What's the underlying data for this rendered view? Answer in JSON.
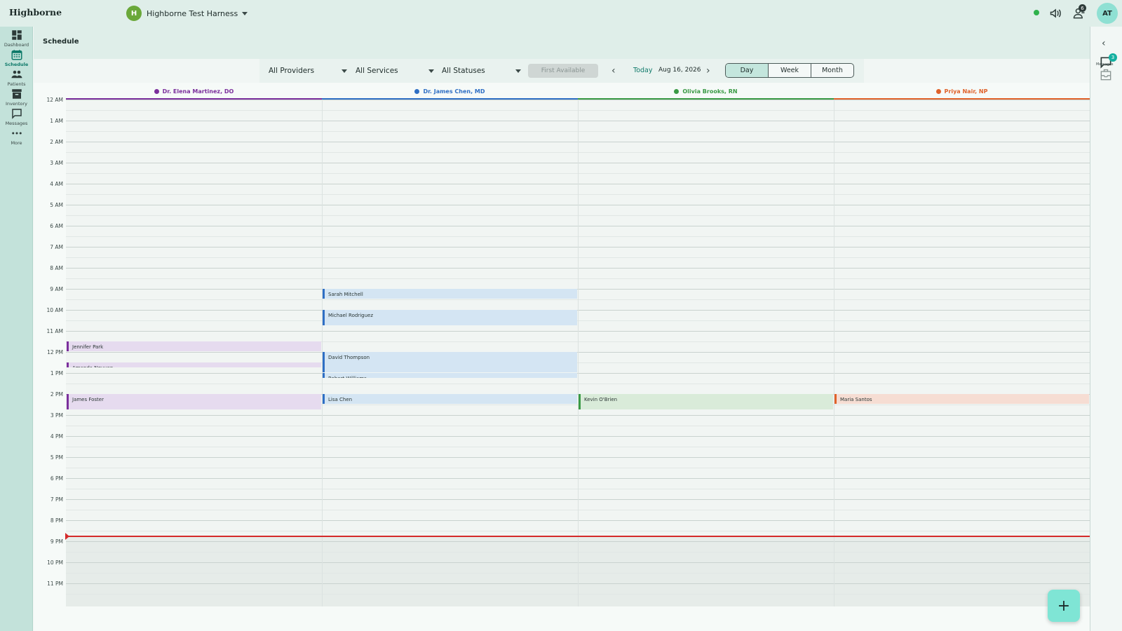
{
  "app": {
    "brand": "Highborne",
    "org_initial": "H",
    "org_name": "Highborne Test Harness",
    "user_initials": "AT",
    "notification_count": "6"
  },
  "sidebar": {
    "items": [
      {
        "label": "Dashboard",
        "icon": "dashboard-icon"
      },
      {
        "label": "Schedule",
        "icon": "calendar-icon",
        "active": true
      },
      {
        "label": "Patients",
        "icon": "patients-icon"
      },
      {
        "label": "Inventory",
        "icon": "inventory-icon"
      },
      {
        "label": "Messages",
        "icon": "messages-icon"
      },
      {
        "label": "More",
        "icon": "more-icon"
      }
    ]
  },
  "right_rail": {
    "messages_badge": "3",
    "messages_label": "Messages"
  },
  "page": {
    "title": "Schedule"
  },
  "toolbar": {
    "providers": "All Providers",
    "services": "All Services",
    "statuses": "All Statuses",
    "first_available": "First Available",
    "today": "Today",
    "date": "Aug 16, 2026",
    "views": [
      "Day",
      "Week",
      "Month"
    ],
    "active_view": "Day"
  },
  "providers": [
    {
      "name": "Dr. Elena Martinez, DO",
      "color": "#7b2f9c"
    },
    {
      "name": "Dr. James Chen, MD",
      "color": "#2f6fc4"
    },
    {
      "name": "Olivia Brooks, RN",
      "color": "#3a9a45"
    },
    {
      "name": "Priya Nair, NP",
      "color": "#e0622a"
    }
  ],
  "hours": [
    "12 AM",
    "1 AM",
    "2 AM",
    "3 AM",
    "4 AM",
    "5 AM",
    "6 AM",
    "7 AM",
    "8 AM",
    "9 AM",
    "10 AM",
    "11 AM",
    "12 PM",
    "1 PM",
    "2 PM",
    "3 PM",
    "4 PM",
    "5 PM",
    "6 PM",
    "7 PM",
    "8 PM",
    "9 PM",
    "10 PM",
    "11 PM"
  ],
  "appointments": [
    {
      "patient": "Sarah Mitchell",
      "provider": 1,
      "start": 9.0,
      "end": 9.5
    },
    {
      "patient": "Michael Rodriguez",
      "provider": 1,
      "start": 10.0,
      "end": 10.75
    },
    {
      "patient": "Jennifer Park",
      "provider": 0,
      "start": 11.5,
      "end": 12.0
    },
    {
      "patient": "Amanda Nguyen",
      "provider": 0,
      "start": 12.5,
      "end": 12.75
    },
    {
      "patient": "David Thompson",
      "provider": 1,
      "start": 12.0,
      "end": 13.0
    },
    {
      "patient": "Robert Williams",
      "provider": 1,
      "start": 13.0,
      "end": 13.25
    },
    {
      "patient": "James Foster",
      "provider": 0,
      "start": 14.0,
      "end": 14.75
    },
    {
      "patient": "Lisa Chen",
      "provider": 1,
      "start": 14.0,
      "end": 14.5
    },
    {
      "patient": "Kevin O'Brien",
      "provider": 2,
      "start": 14.0,
      "end": 14.75
    },
    {
      "patient": "Maria Santos",
      "provider": 3,
      "start": 14.0,
      "end": 14.5
    }
  ],
  "current_time": 20.75,
  "fab_label": "+"
}
